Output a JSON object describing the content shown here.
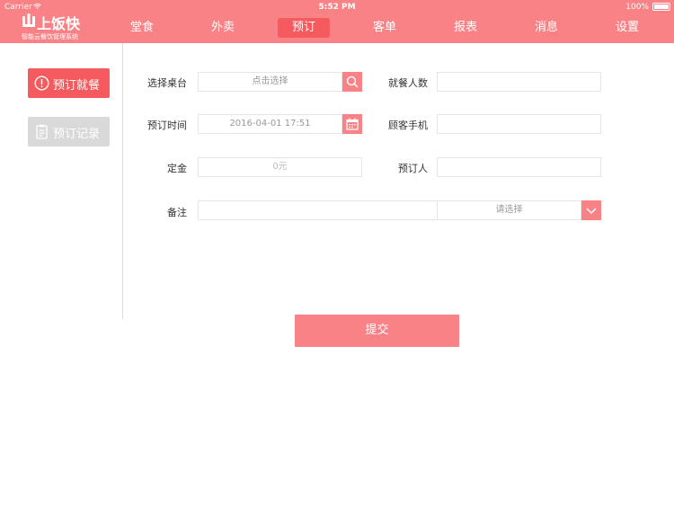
{
  "status_bar": {
    "carrier": "Carrier",
    "time": "5:52 PM",
    "battery": "100%"
  },
  "logo": {
    "brand": "上饭快",
    "slogan": "智能云餐饮管理系统"
  },
  "nav": {
    "items": [
      {
        "label": "堂食"
      },
      {
        "label": "外卖"
      },
      {
        "label": "预订"
      },
      {
        "label": "客单"
      },
      {
        "label": "报表"
      },
      {
        "label": "消息"
      },
      {
        "label": "设置"
      }
    ],
    "active_index": 2
  },
  "sidebar": {
    "reserve_label": "预订就餐",
    "records_label": "预订记录"
  },
  "form": {
    "table": {
      "label": "选择桌台",
      "placeholder": "点击选择"
    },
    "guests": {
      "label": "就餐人数",
      "value": ""
    },
    "time": {
      "label": "预订时间",
      "value": "2016-04-01 17:51"
    },
    "phone": {
      "label": "顾客手机",
      "value": ""
    },
    "deposit": {
      "label": "定金",
      "placeholder": "0元"
    },
    "reserver": {
      "label": "预订人",
      "value": ""
    },
    "note": {
      "label": "备注",
      "value": "",
      "select_placeholder": "请选择"
    },
    "submit_label": "提交"
  },
  "colors": {
    "header": "#f88286",
    "active": "#f55a5f",
    "disabled": "#d9d9d9"
  }
}
